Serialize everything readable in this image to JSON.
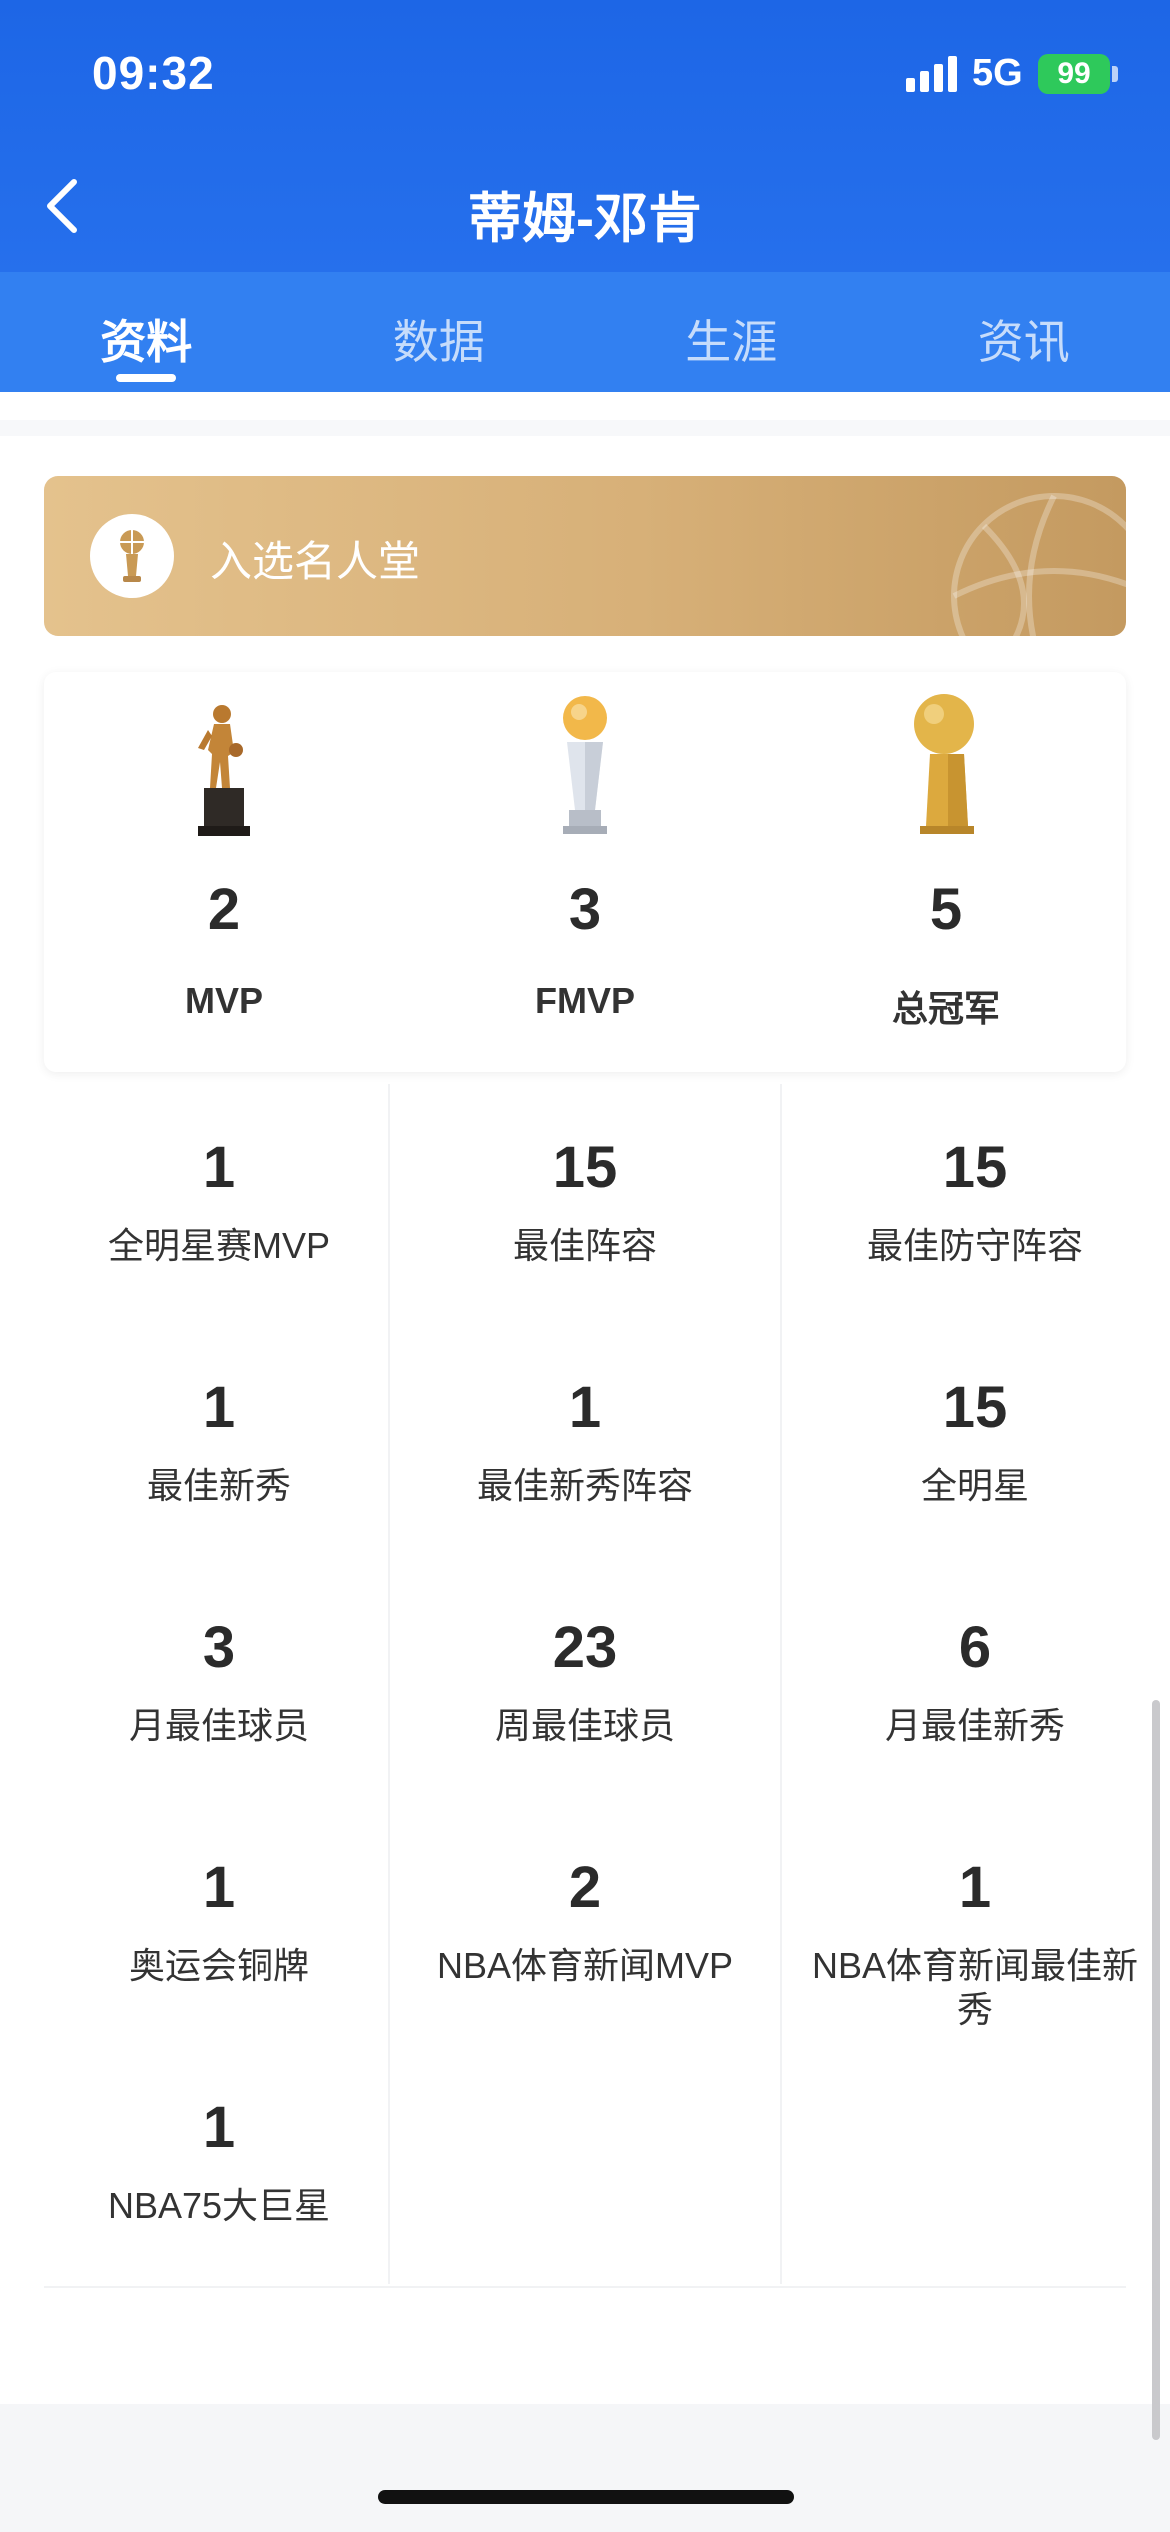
{
  "status_bar": {
    "time": "09:32",
    "network": "5G",
    "battery": "99"
  },
  "navbar": {
    "title": "蒂姆-邓肯"
  },
  "tabs": [
    {
      "label": "资料",
      "active": true
    },
    {
      "label": "数据",
      "active": false
    },
    {
      "label": "生涯",
      "active": false
    },
    {
      "label": "资讯",
      "active": false
    }
  ],
  "hall_of_fame": {
    "label": "入选名人堂"
  },
  "awards": [
    {
      "count": "2",
      "label": "MVP",
      "icon": "mvp-trophy-icon"
    },
    {
      "count": "3",
      "label": "FMVP",
      "icon": "fmvp-trophy-icon"
    },
    {
      "count": "5",
      "label": "总冠军",
      "icon": "championship-trophy-icon"
    }
  ],
  "honors": [
    {
      "count": "1",
      "label": "全明星赛MVP"
    },
    {
      "count": "15",
      "label": "最佳阵容"
    },
    {
      "count": "15",
      "label": "最佳防守阵容"
    },
    {
      "count": "1",
      "label": "最佳新秀"
    },
    {
      "count": "1",
      "label": "最佳新秀阵容"
    },
    {
      "count": "15",
      "label": "全明星"
    },
    {
      "count": "3",
      "label": "月最佳球员"
    },
    {
      "count": "23",
      "label": "周最佳球员"
    },
    {
      "count": "6",
      "label": "月最佳新秀"
    },
    {
      "count": "1",
      "label": "奥运会铜牌"
    },
    {
      "count": "2",
      "label": "NBA体育新闻MVP"
    },
    {
      "count": "1",
      "label": "NBA体育新闻最佳新秀"
    },
    {
      "count": "1",
      "label": "NBA75大巨星"
    }
  ],
  "colors": {
    "header": "#1d66e6",
    "tabs": "#3280f1",
    "gold": "#d7b078"
  }
}
